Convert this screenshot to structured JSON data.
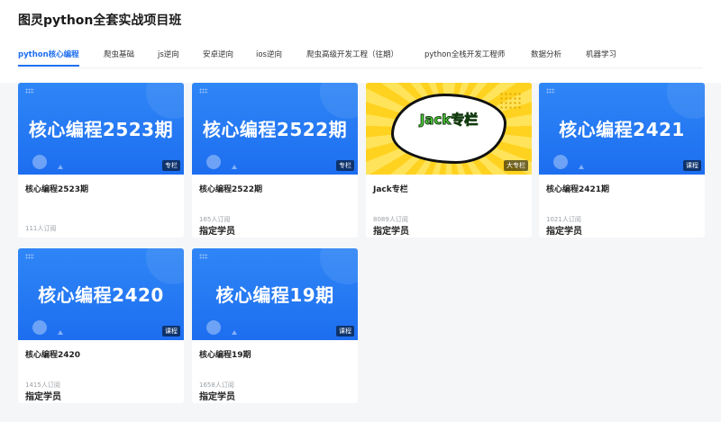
{
  "page": {
    "title": "图灵python全套实战项目班"
  },
  "tabs": [
    {
      "label": "python核心编程",
      "active": true
    },
    {
      "label": "爬虫基础"
    },
    {
      "label": "js逆向"
    },
    {
      "label": "安卓逆向"
    },
    {
      "label": "ios逆向"
    },
    {
      "label": "爬虫高级开发工程（往期）"
    },
    {
      "label": "python全栈开发工程师"
    },
    {
      "label": "数据分析"
    },
    {
      "label": "机器学习"
    }
  ],
  "cards": [
    {
      "banner": "核心编程2523期",
      "badge": "专栏",
      "title": "核心编程2523期",
      "subs": "111人订阅",
      "assign": ""
    },
    {
      "banner": "核心编程2522期",
      "badge": "专栏",
      "title": "核心编程2522期",
      "subs": "165人订阅",
      "assign": "指定学员"
    },
    {
      "banner": "Jack专栏",
      "badge": "大专栏",
      "title": "Jack专栏",
      "subs": "8089人订阅",
      "assign": "指定学员"
    },
    {
      "banner": "核心编程2421",
      "badge": "课程",
      "title": "核心编程2421期",
      "subs": "1021人订阅",
      "assign": "指定学员"
    },
    {
      "banner": "核心编程2420",
      "badge": "课程",
      "title": "核心编程2420",
      "subs": "1415人订阅",
      "assign": "指定学员"
    },
    {
      "banner": "核心编程19期",
      "badge": "课程",
      "title": "核心编程19期",
      "subs": "1658人订阅",
      "assign": "指定学员"
    }
  ],
  "colors": {
    "accent": "#1e6ff1",
    "banner_blue": "#2079f2",
    "jack_yellow": "#ffd21f"
  }
}
